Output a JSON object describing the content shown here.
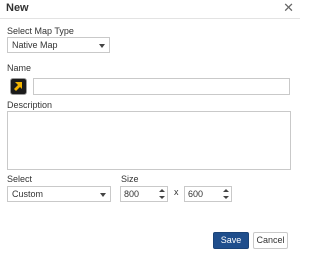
{
  "dialog": {
    "title": "New"
  },
  "map_type": {
    "label": "Select Map Type",
    "selected": "Native Map"
  },
  "name": {
    "label": "Name",
    "value": ""
  },
  "description": {
    "label": "Description",
    "value": ""
  },
  "select": {
    "label": "Select",
    "selected": "Custom"
  },
  "size": {
    "label": "Size",
    "width": "800",
    "separator": "x",
    "height": "600"
  },
  "buttons": {
    "save": "Save",
    "cancel": "Cancel"
  },
  "icons": {
    "close": "close-icon",
    "map": "map-icon"
  },
  "colors": {
    "primary_button": "#1f4e8c",
    "icon_yellow": "#f2b400"
  }
}
